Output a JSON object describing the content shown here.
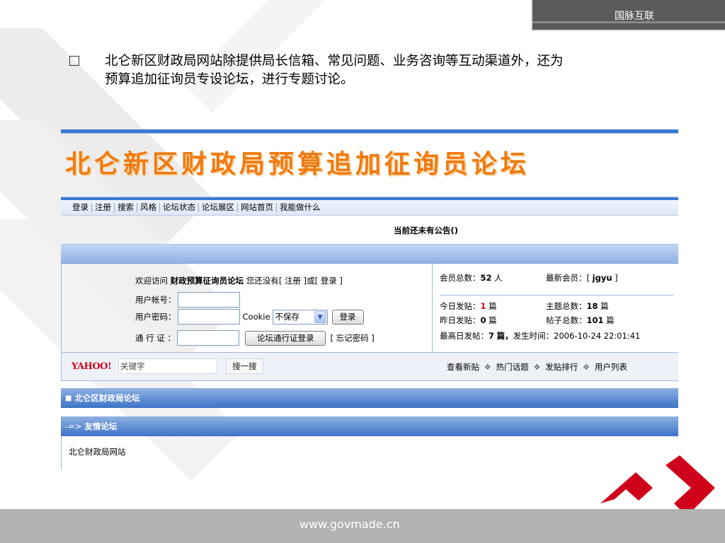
{
  "brand": "国脉互联",
  "slide": {
    "bullet": "北仑新区财政局网站除提供局长信箱、常见问题、业务咨询等互动渠道外，还为预算追加征询员专设论坛，进行专题讨论。"
  },
  "forum": {
    "title": "北仑新区财政局预算追加征询员论坛",
    "nav": [
      "登录",
      "注册",
      "搜索",
      "风格",
      "论坛状态",
      "论坛展区",
      "网站首页",
      "我能做什么"
    ],
    "announcement": "当前还未有公告()",
    "welcome": {
      "prefix": "欢迎访问",
      "forum_name": "财政预算征询员论坛",
      "suffix_a": "您还没有",
      "register": "[ 注册 ]",
      "or": "或",
      "login": "[ 登录 ]"
    },
    "login": {
      "user_label": "用户帐号：",
      "user_value": "",
      "password_label": "用户密码：",
      "password_value": "",
      "cookie_label": "Cookie",
      "cookie_value": "不保存",
      "login_button": "登录",
      "pass_label": "通 行 证 ：",
      "pass_value": "",
      "pass_button": "论坛通行证登录",
      "forgot": "[ 忘记密码 ]"
    },
    "stats": {
      "members_label": "会员总数：",
      "members_value": "52",
      "members_unit": "人",
      "newest_label": "最新会员：",
      "newest_value": "jgyu",
      "today_label": "今日发贴：",
      "today_value": "1",
      "today_unit": "篇",
      "topics_label": "主题总数：",
      "topics_value": "18",
      "topics_unit": "篇",
      "yesterday_label": "昨日发贴：",
      "yesterday_value": "0",
      "yesterday_unit": "篇",
      "posts_label": "帖子总数：",
      "posts_value": "101",
      "posts_unit": "篇",
      "max_label": "最高日发帖：",
      "max_value": "7",
      "max_unit": "篇，",
      "time_label": "发生时间：",
      "time_value": "2006-10-24 22:01:41"
    },
    "search": {
      "logo": "YAHOO!",
      "placeholder": "关键字",
      "button": "搜一搜"
    },
    "quick_links": [
      "查看新贴",
      "热门话题",
      "发贴排行",
      "用户列表"
    ],
    "section_forum": "北仑区财政局论坛",
    "section_friends_prefix": "-=>",
    "section_friends": "友情论坛",
    "friend_link": "北仑财政局网站"
  },
  "footer": "www.govmade.cn",
  "colors": {
    "accent_blue": "#3a7ad0",
    "title_orange": "#f07a10",
    "brand_red": "#d0021b",
    "footer_gray": "#b2b2b2"
  }
}
